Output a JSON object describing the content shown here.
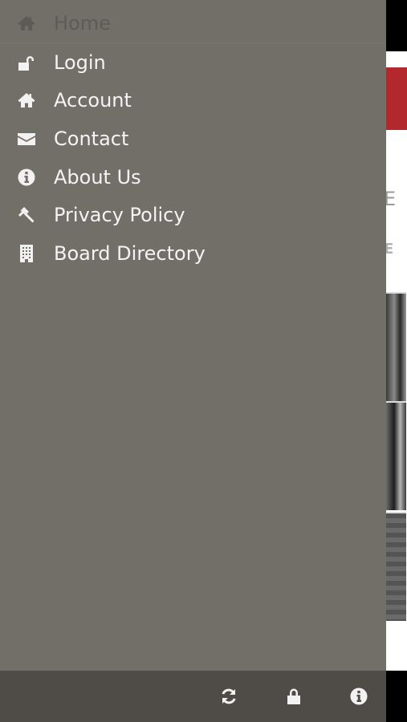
{
  "background_app": {
    "heading_fragment": "E",
    "subheading_fragment": "E"
  },
  "drawer": {
    "items": [
      {
        "label": "Home",
        "icon": "home-icon",
        "active": false
      },
      {
        "label": "Login",
        "icon": "unlock-icon"
      },
      {
        "label": "Account",
        "icon": "home-icon"
      },
      {
        "label": "Contact",
        "icon": "envelope-icon"
      },
      {
        "label": "About Us",
        "icon": "info-circle-icon"
      },
      {
        "label": "Privacy Policy",
        "icon": "gavel-icon"
      },
      {
        "label": "Board Directory",
        "icon": "building-icon"
      }
    ],
    "footer_icons": [
      "refresh-icon",
      "lock-icon",
      "info-circle-icon"
    ]
  },
  "colors": {
    "drawer_bg": "#726e68",
    "footer_bg": "#4f4c48",
    "accent_red": "#b3282d",
    "menu_text": "#f4f4f4"
  }
}
